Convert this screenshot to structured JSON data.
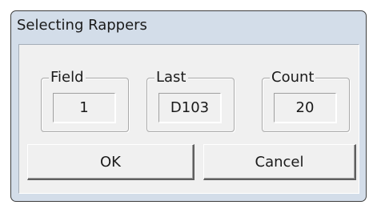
{
  "window": {
    "title": "Selecting Rappers"
  },
  "fields": [
    {
      "legend": "Field",
      "value": "1"
    },
    {
      "legend": "Last",
      "value": "D103"
    },
    {
      "legend": "Count",
      "value": "20"
    }
  ],
  "buttons": {
    "ok": "OK",
    "cancel": "Cancel"
  }
}
